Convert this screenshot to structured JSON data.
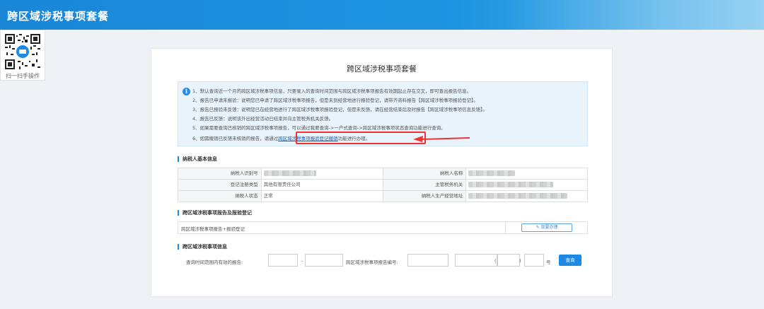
{
  "app": {
    "title": "跨区域涉税事项套餐"
  },
  "qr": {
    "label": "扫一扫手操作"
  },
  "panel": {
    "title": "跨区域涉税事项套餐"
  },
  "notice": {
    "lines": [
      "1、默认查询近一个月的跨区域涉税事项信息，只要录入的查询时间范围与跨区域涉税事项报告有效期起止存在交叉，即可查出报告信息。",
      "2、报告已申请未报验：说明您已申请了跨区域涉税事项报告，但是未到经营地进行报验登记，请带齐资料报告【跨区域涉税事项报验登记】。",
      "3、报告已报验未反馈：说明您已在经营地进行了跨区域涉税事项报验登记，但是未反馈，请在经营结束后及时报告【跨区域涉税事项信息反馈】。",
      "4、报告已反馈：说明该外出经营活动已结束并向主管税务机关反馈。",
      "5、如果需要查询已核销的跨区域涉税事项报告，可以通过我要查询->一户式查询->跨区域涉税事项状态查询功能进行查询。"
    ],
    "line6_prefix": "6、如需撤销已反馈未核销的报告，",
    "line6_pre_link": "请通过",
    "line6_link": "跨区域涉税事项报验登记撤销",
    "line6_post_link": "功能进行办理。"
  },
  "taxpayer_section": {
    "title": "纳税人基本信息",
    "labels": {
      "id": "纳税人识别号",
      "name": "纳税人名称",
      "reg_type": "登记注册类型",
      "authority": "主管税务机关",
      "status": "纳税人状态",
      "address": "纳税人生产经营地址"
    },
    "values": {
      "reg_type": "其他有限责任公司",
      "status": "正常"
    }
  },
  "report_section": {
    "title": "跨区域涉税事项报告及报验登记",
    "row_text": "跨区域涉税事项报告+报验登记",
    "button_icon": "edit-icon",
    "button_label": "我要办理"
  },
  "query_section": {
    "title": "跨区域涉税事项信息",
    "range_label": "查询时间范围内有效的报告:",
    "dash": "-",
    "number_label": "跨区域涉税事项报告编号:",
    "paren_open": "(",
    "paren_close": ")",
    "hao": "号",
    "query_button": "查询"
  },
  "colors": {
    "brand": "#1e88e5",
    "highlight_box": "#e33333",
    "notice_bg": "#e8f3fc"
  }
}
